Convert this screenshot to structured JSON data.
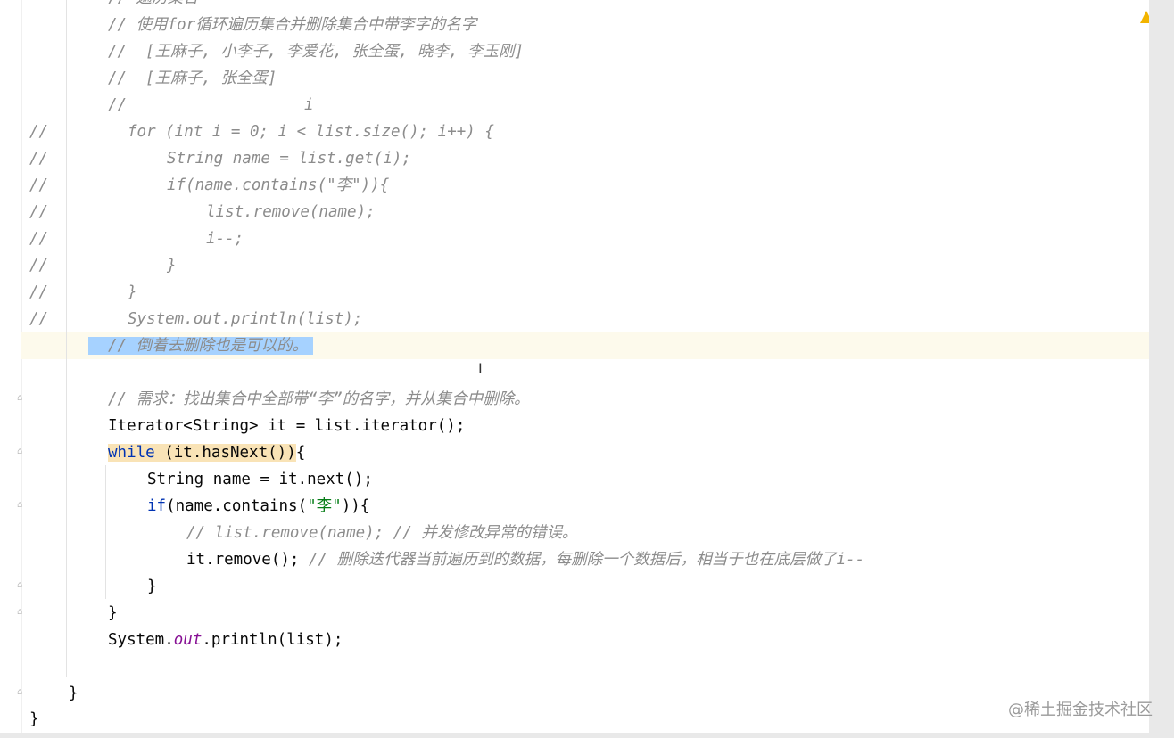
{
  "editor": {
    "lines": {
      "l0": "// 遍历集合",
      "l1": "// 使用for循环遍历集合并删除集合中带李字的名字",
      "l2": "//  [王麻子, 小李子, 李爱花, 张全蛋, 晓李, 李玉刚]",
      "l3": "//  [王麻子, 张全蛋]",
      "l4a": "//",
      "l4b": "i",
      "l5a": "//",
      "l5b": "for (int i = 0; i < list.size(); i++) {",
      "l6a": "//",
      "l6b": "String name = list.get(i);",
      "l7a": "//",
      "l7b": "if(name.contains(\"李\")){",
      "l8a": "//",
      "l8b": "list.remove(name);",
      "l9a": "//",
      "l9b": "i--;",
      "l10a": "//",
      "l10b": "}",
      "l11a": "//",
      "l11b": "}",
      "l12a": "//",
      "l12b": "System.out.println(list);",
      "l13": "// 倒着去删除也是可以的。",
      "l15": "// 需求：找出集合中全部带“李”的名字，并从集合中删除。",
      "l16": "Iterator<String> it = list.iterator();",
      "l17_kw": "while",
      "l17_rest": " (it.hasNext())",
      "l17_brace": "{",
      "l18": "String name = it.next();",
      "l19_kw": "if",
      "l19_a": "(name.contains(",
      "l19_str": "\"李\"",
      "l19_b": ")){",
      "l20": "// list.remove(name); // 并发修改异常的错误。",
      "l21_code": "it.remove(); ",
      "l21_cm": "// 删除迭代器当前遍历到的数据，每删除一个数据后，相当于也在底层做了i--",
      "l22": "}",
      "l23": "}",
      "l24_a": "System.",
      "l24_fld": "out",
      "l24_b": ".println(list);",
      "l26": "}",
      "l27": "}"
    }
  },
  "watermark": "@稀土掘金技术社区",
  "colors": {
    "comment": "#8c8c8c",
    "keyword": "#0033b3",
    "string": "#067d17",
    "field": "#871094",
    "selection": "#a6d2ff",
    "current_line": "#fdfaec",
    "warning": "#f2b400"
  },
  "icons": [
    "warning-icon",
    "fold-marker-icon",
    "text-caret-icon"
  ]
}
